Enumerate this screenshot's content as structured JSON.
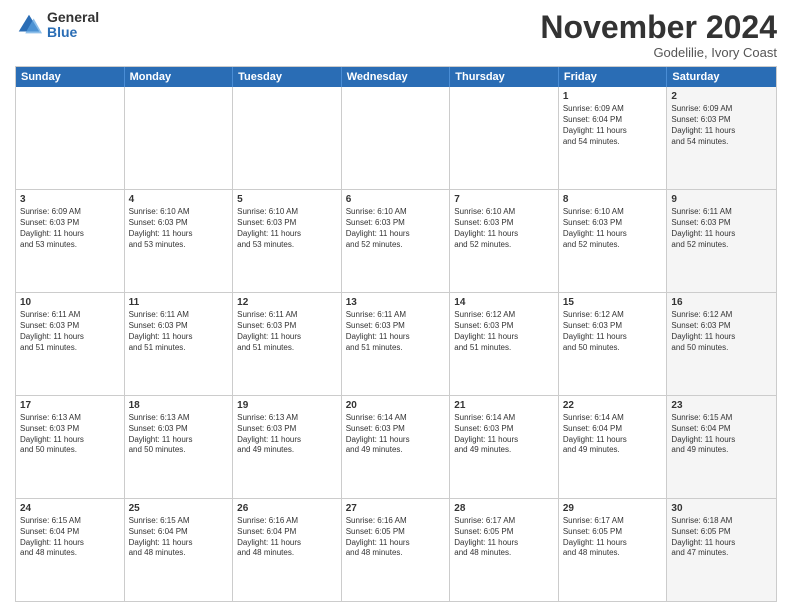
{
  "logo": {
    "general": "General",
    "blue": "Blue"
  },
  "header": {
    "month": "November 2024",
    "location": "Godelilie, Ivory Coast"
  },
  "weekdays": [
    "Sunday",
    "Monday",
    "Tuesday",
    "Wednesday",
    "Thursday",
    "Friday",
    "Saturday"
  ],
  "rows": [
    [
      {
        "day": "",
        "info": "",
        "shaded": false
      },
      {
        "day": "",
        "info": "",
        "shaded": false
      },
      {
        "day": "",
        "info": "",
        "shaded": false
      },
      {
        "day": "",
        "info": "",
        "shaded": false
      },
      {
        "day": "",
        "info": "",
        "shaded": false
      },
      {
        "day": "1",
        "info": "Sunrise: 6:09 AM\nSunset: 6:04 PM\nDaylight: 11 hours\nand 54 minutes.",
        "shaded": false
      },
      {
        "day": "2",
        "info": "Sunrise: 6:09 AM\nSunset: 6:03 PM\nDaylight: 11 hours\nand 54 minutes.",
        "shaded": true
      }
    ],
    [
      {
        "day": "3",
        "info": "Sunrise: 6:09 AM\nSunset: 6:03 PM\nDaylight: 11 hours\nand 53 minutes.",
        "shaded": false
      },
      {
        "day": "4",
        "info": "Sunrise: 6:10 AM\nSunset: 6:03 PM\nDaylight: 11 hours\nand 53 minutes.",
        "shaded": false
      },
      {
        "day": "5",
        "info": "Sunrise: 6:10 AM\nSunset: 6:03 PM\nDaylight: 11 hours\nand 53 minutes.",
        "shaded": false
      },
      {
        "day": "6",
        "info": "Sunrise: 6:10 AM\nSunset: 6:03 PM\nDaylight: 11 hours\nand 52 minutes.",
        "shaded": false
      },
      {
        "day": "7",
        "info": "Sunrise: 6:10 AM\nSunset: 6:03 PM\nDaylight: 11 hours\nand 52 minutes.",
        "shaded": false
      },
      {
        "day": "8",
        "info": "Sunrise: 6:10 AM\nSunset: 6:03 PM\nDaylight: 11 hours\nand 52 minutes.",
        "shaded": false
      },
      {
        "day": "9",
        "info": "Sunrise: 6:11 AM\nSunset: 6:03 PM\nDaylight: 11 hours\nand 52 minutes.",
        "shaded": true
      }
    ],
    [
      {
        "day": "10",
        "info": "Sunrise: 6:11 AM\nSunset: 6:03 PM\nDaylight: 11 hours\nand 51 minutes.",
        "shaded": false
      },
      {
        "day": "11",
        "info": "Sunrise: 6:11 AM\nSunset: 6:03 PM\nDaylight: 11 hours\nand 51 minutes.",
        "shaded": false
      },
      {
        "day": "12",
        "info": "Sunrise: 6:11 AM\nSunset: 6:03 PM\nDaylight: 11 hours\nand 51 minutes.",
        "shaded": false
      },
      {
        "day": "13",
        "info": "Sunrise: 6:11 AM\nSunset: 6:03 PM\nDaylight: 11 hours\nand 51 minutes.",
        "shaded": false
      },
      {
        "day": "14",
        "info": "Sunrise: 6:12 AM\nSunset: 6:03 PM\nDaylight: 11 hours\nand 51 minutes.",
        "shaded": false
      },
      {
        "day": "15",
        "info": "Sunrise: 6:12 AM\nSunset: 6:03 PM\nDaylight: 11 hours\nand 50 minutes.",
        "shaded": false
      },
      {
        "day": "16",
        "info": "Sunrise: 6:12 AM\nSunset: 6:03 PM\nDaylight: 11 hours\nand 50 minutes.",
        "shaded": true
      }
    ],
    [
      {
        "day": "17",
        "info": "Sunrise: 6:13 AM\nSunset: 6:03 PM\nDaylight: 11 hours\nand 50 minutes.",
        "shaded": false
      },
      {
        "day": "18",
        "info": "Sunrise: 6:13 AM\nSunset: 6:03 PM\nDaylight: 11 hours\nand 50 minutes.",
        "shaded": false
      },
      {
        "day": "19",
        "info": "Sunrise: 6:13 AM\nSunset: 6:03 PM\nDaylight: 11 hours\nand 49 minutes.",
        "shaded": false
      },
      {
        "day": "20",
        "info": "Sunrise: 6:14 AM\nSunset: 6:03 PM\nDaylight: 11 hours\nand 49 minutes.",
        "shaded": false
      },
      {
        "day": "21",
        "info": "Sunrise: 6:14 AM\nSunset: 6:03 PM\nDaylight: 11 hours\nand 49 minutes.",
        "shaded": false
      },
      {
        "day": "22",
        "info": "Sunrise: 6:14 AM\nSunset: 6:04 PM\nDaylight: 11 hours\nand 49 minutes.",
        "shaded": false
      },
      {
        "day": "23",
        "info": "Sunrise: 6:15 AM\nSunset: 6:04 PM\nDaylight: 11 hours\nand 49 minutes.",
        "shaded": true
      }
    ],
    [
      {
        "day": "24",
        "info": "Sunrise: 6:15 AM\nSunset: 6:04 PM\nDaylight: 11 hours\nand 48 minutes.",
        "shaded": false
      },
      {
        "day": "25",
        "info": "Sunrise: 6:15 AM\nSunset: 6:04 PM\nDaylight: 11 hours\nand 48 minutes.",
        "shaded": false
      },
      {
        "day": "26",
        "info": "Sunrise: 6:16 AM\nSunset: 6:04 PM\nDaylight: 11 hours\nand 48 minutes.",
        "shaded": false
      },
      {
        "day": "27",
        "info": "Sunrise: 6:16 AM\nSunset: 6:05 PM\nDaylight: 11 hours\nand 48 minutes.",
        "shaded": false
      },
      {
        "day": "28",
        "info": "Sunrise: 6:17 AM\nSunset: 6:05 PM\nDaylight: 11 hours\nand 48 minutes.",
        "shaded": false
      },
      {
        "day": "29",
        "info": "Sunrise: 6:17 AM\nSunset: 6:05 PM\nDaylight: 11 hours\nand 48 minutes.",
        "shaded": false
      },
      {
        "day": "30",
        "info": "Sunrise: 6:18 AM\nSunset: 6:05 PM\nDaylight: 11 hours\nand 47 minutes.",
        "shaded": true
      }
    ]
  ]
}
